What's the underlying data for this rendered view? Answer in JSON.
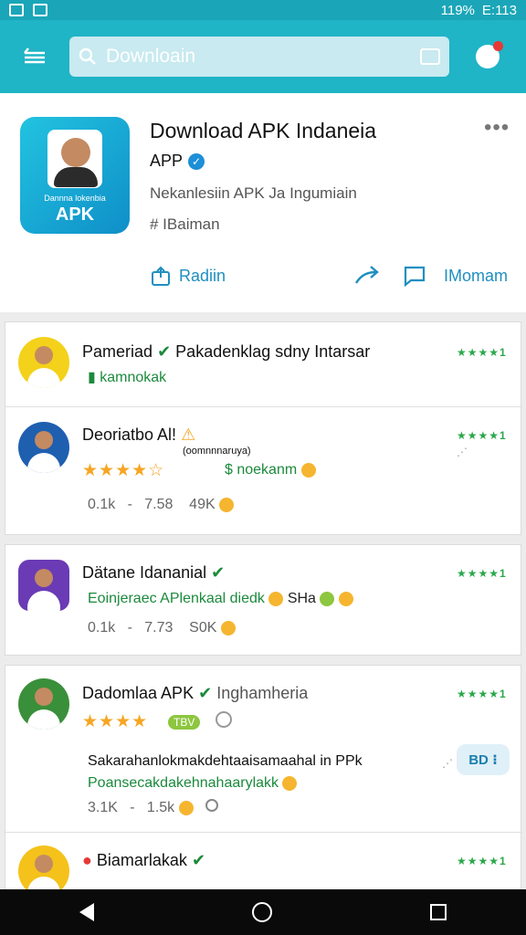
{
  "status_bar": {
    "battery": "119%",
    "time": "E:113"
  },
  "search": {
    "query": "Downloain"
  },
  "hero": {
    "title": "Download APK Indaneia",
    "brand": "APP",
    "description": "Nekanlesiin APK Ja Ingumiain",
    "tag": "# IBaiman",
    "action_left": "Radiin",
    "action_right": "IMomam",
    "icon_caption": "Dannna lokenbia",
    "icon_label": "APK"
  },
  "list": [
    {
      "name": "Pameriad",
      "title_suffix": "Pakadenklag sdny Intarsar",
      "rating": "★★★★1",
      "badge": "kamnokak"
    },
    {
      "name": "Deoriatbo Al!",
      "note": "(oomnnnaruya)",
      "rating": "★★★★1",
      "stars": "★★★★☆",
      "green_text": "$ noekanm",
      "stats": [
        "0.1k",
        "7.58",
        "49K"
      ]
    },
    {
      "name": "Dätane Idananial",
      "rating": "★★★★1",
      "subtitle": "Eoinjeraec APlenkaal diedk",
      "subtitle_suffix": "SHa",
      "stats": [
        "0.1k",
        "7.73",
        "S0K"
      ]
    },
    {
      "name": "Dadomlaa APK",
      "name_suffix": "Inghamheria",
      "rating": "★★★★1",
      "stars": "★★★★",
      "chip": "TBV",
      "line1": "Sakarahanlokmakdehtaaisamaahal in PPk",
      "line2": "Poansecakdakehnahaarylakk",
      "stats": [
        "3.1K",
        "1.5k"
      ],
      "button": "BD"
    },
    {
      "name": "Biamarlakak",
      "rating": "★★★★1"
    }
  ]
}
